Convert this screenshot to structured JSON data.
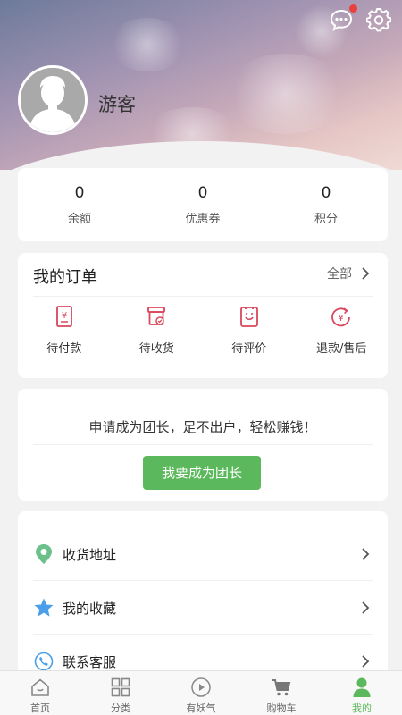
{
  "header": {
    "username": "游客",
    "has_unread_message": true
  },
  "stats": [
    {
      "value": "0",
      "label": "余额"
    },
    {
      "value": "0",
      "label": "优惠券"
    },
    {
      "value": "0",
      "label": "积分"
    }
  ],
  "orders": {
    "title": "我的订单",
    "all_label": "全部",
    "items": [
      {
        "label": "待付款",
        "icon": "payment-pending-icon"
      },
      {
        "label": "待收货",
        "icon": "delivery-pending-icon"
      },
      {
        "label": "待评价",
        "icon": "review-pending-icon"
      },
      {
        "label": "退款/售后",
        "icon": "refund-icon"
      }
    ]
  },
  "leader": {
    "text": "申请成为团长，足不出户，轻松赚钱！",
    "button_label": "我要成为团长"
  },
  "menu": [
    {
      "label": "收货地址",
      "icon": "location-pin-icon"
    },
    {
      "label": "我的收藏",
      "icon": "star-icon"
    },
    {
      "label": "联系客服",
      "icon": "phone-icon"
    }
  ],
  "tabbar": [
    {
      "label": "首页",
      "icon": "home-icon",
      "active": false
    },
    {
      "label": "分类",
      "icon": "grid-icon",
      "active": false
    },
    {
      "label": "有妖气",
      "icon": "play-icon",
      "active": false
    },
    {
      "label": "购物车",
      "icon": "cart-icon",
      "active": false
    },
    {
      "label": "我的",
      "icon": "user-icon",
      "active": true
    }
  ],
  "colors": {
    "accent_green": "#5cb85c",
    "icon_red": "#d9475b",
    "badge_red": "#e8413b"
  }
}
